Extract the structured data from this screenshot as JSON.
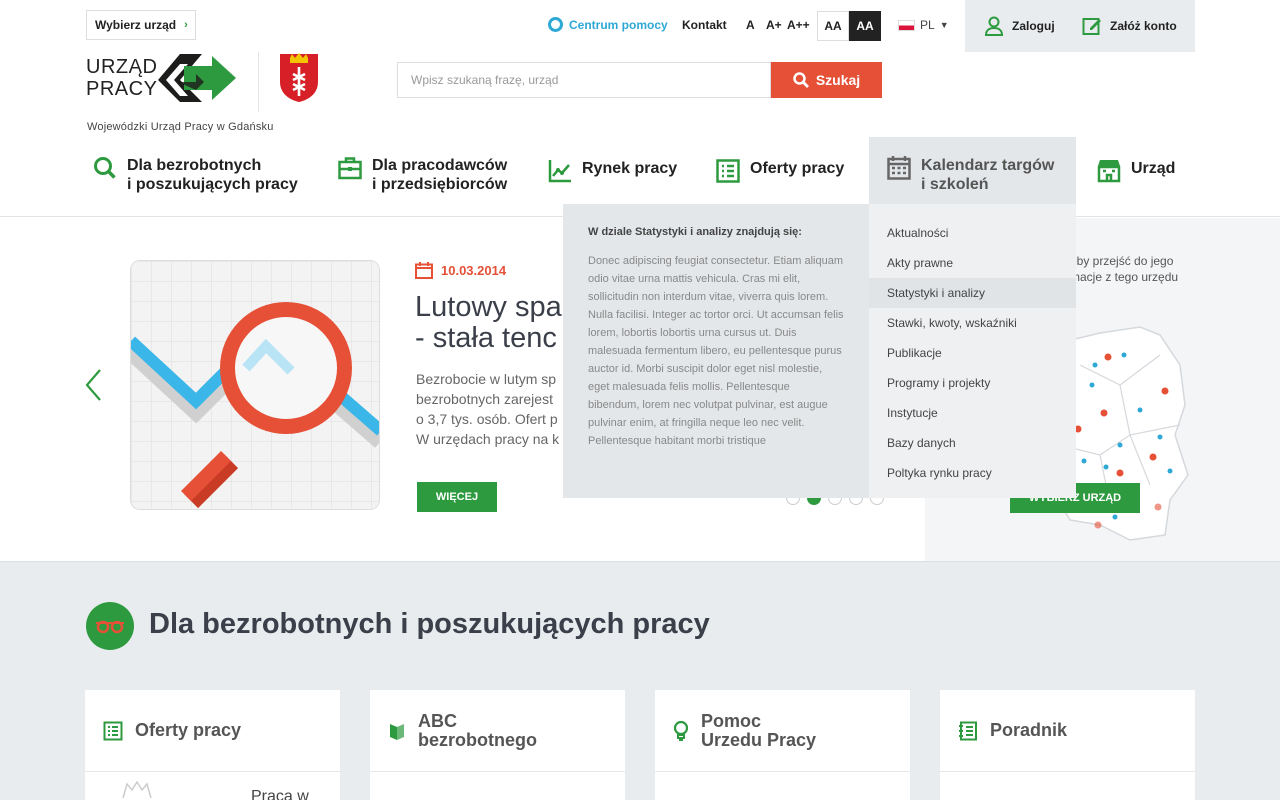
{
  "topbar": {
    "select_office": "Wybierz urząd",
    "help": "Centrum pomocy",
    "contact": "Kontakt",
    "font_sizes": [
      "A",
      "A+",
      "A++"
    ],
    "contrast_light": "AA",
    "contrast_dark": "AA",
    "language": "PL",
    "login": "Zaloguj",
    "register": "Załóż konto"
  },
  "logo": {
    "line1": "URZĄD",
    "line2": "PRACY",
    "caption": "Wojewódzki Urząd Pracy w Gdańsku"
  },
  "search": {
    "placeholder": "Wpisz szukaną frazę, urząd",
    "button": "Szukaj"
  },
  "nav": [
    {
      "line1": "Dla bezrobotnych",
      "line2": "i poszukujących pracy",
      "icon": "search-icon"
    },
    {
      "line1": "Dla pracodawców",
      "line2": "i przedsiębiorców",
      "icon": "briefcase-icon"
    },
    {
      "line1": "Rynek pracy",
      "line2": "",
      "icon": "chart-icon"
    },
    {
      "line1": "Oferty pracy",
      "line2": "",
      "icon": "list-icon"
    },
    {
      "line1": "Kalendarz targów",
      "line2": "i szkoleń",
      "icon": "calendar-icon"
    },
    {
      "line1": "Urząd",
      "line2": "",
      "icon": "building-icon"
    }
  ],
  "hero": {
    "date": "10.03.2014",
    "title_line1": "Lutowy spa",
    "title_line2": "- stała tenc",
    "text": [
      "Bezrobocie w lutym sp",
      "bezrobotnych zarejest",
      "o 3,7 tys. osób. Ofert p",
      "W urzędach pracy na k"
    ],
    "more": "WIĘCEJ",
    "slides": 5,
    "active_slide": 2
  },
  "map": {
    "info_line1": "eby przejść do jego",
    "info_line2": "macje z tego urzędu",
    "button": "WYBIERZ URZĄD"
  },
  "dropdown": {
    "heading": "W dziale Statystyki i analizy znajdują się:",
    "text": "Donec adipiscing feugiat consectetur. Etiam aliquam odio vitae urna mattis vehicula. Cras mi elit, sollicitudin non interdum vitae, viverra quis lorem. Nulla facilisi. Integer ac tortor orci. Ut accumsan felis lorem, lobortis lobortis urna cursus ut. Duis malesuada fermentum libero, eu pellentesque purus auctor id. Morbi suscipit dolor eget nisl molestie, eget malesuada felis mollis. Pellentesque bibendum, lorem nec volutpat pulvinar, est augue pulvinar enim, at fringilla neque leo nec velit. Pellentesque habitant morbi tristique",
    "items": [
      "Aktualności",
      "Akty prawne",
      "Statystyki i analizy",
      "Stawki, kwoty, wskaźniki",
      "Publikacje",
      "Programy i projekty",
      "Instytucje",
      "Bazy danych",
      "Poltyka rynku pracy"
    ],
    "active_index": 2
  },
  "section": {
    "title": "Dla bezrobotnych i poszukujących pracy",
    "cards": [
      {
        "line1": "Oferty pracy",
        "line2": "",
        "icon": "list-icon"
      },
      {
        "line1": "ABC",
        "line2": "bezrobotnego",
        "icon": "book-icon"
      },
      {
        "line1": "Pomoc",
        "line2": "Urzedu Pracy",
        "icon": "bulb-icon"
      },
      {
        "line1": "Poradnik",
        "line2": "",
        "icon": "document-icon"
      }
    ],
    "card_sub": "Praca w"
  },
  "colors": {
    "green": "#2e9a3f",
    "red": "#e55036",
    "blue": "#2ea8d5",
    "dark": "#3b3f4a"
  }
}
